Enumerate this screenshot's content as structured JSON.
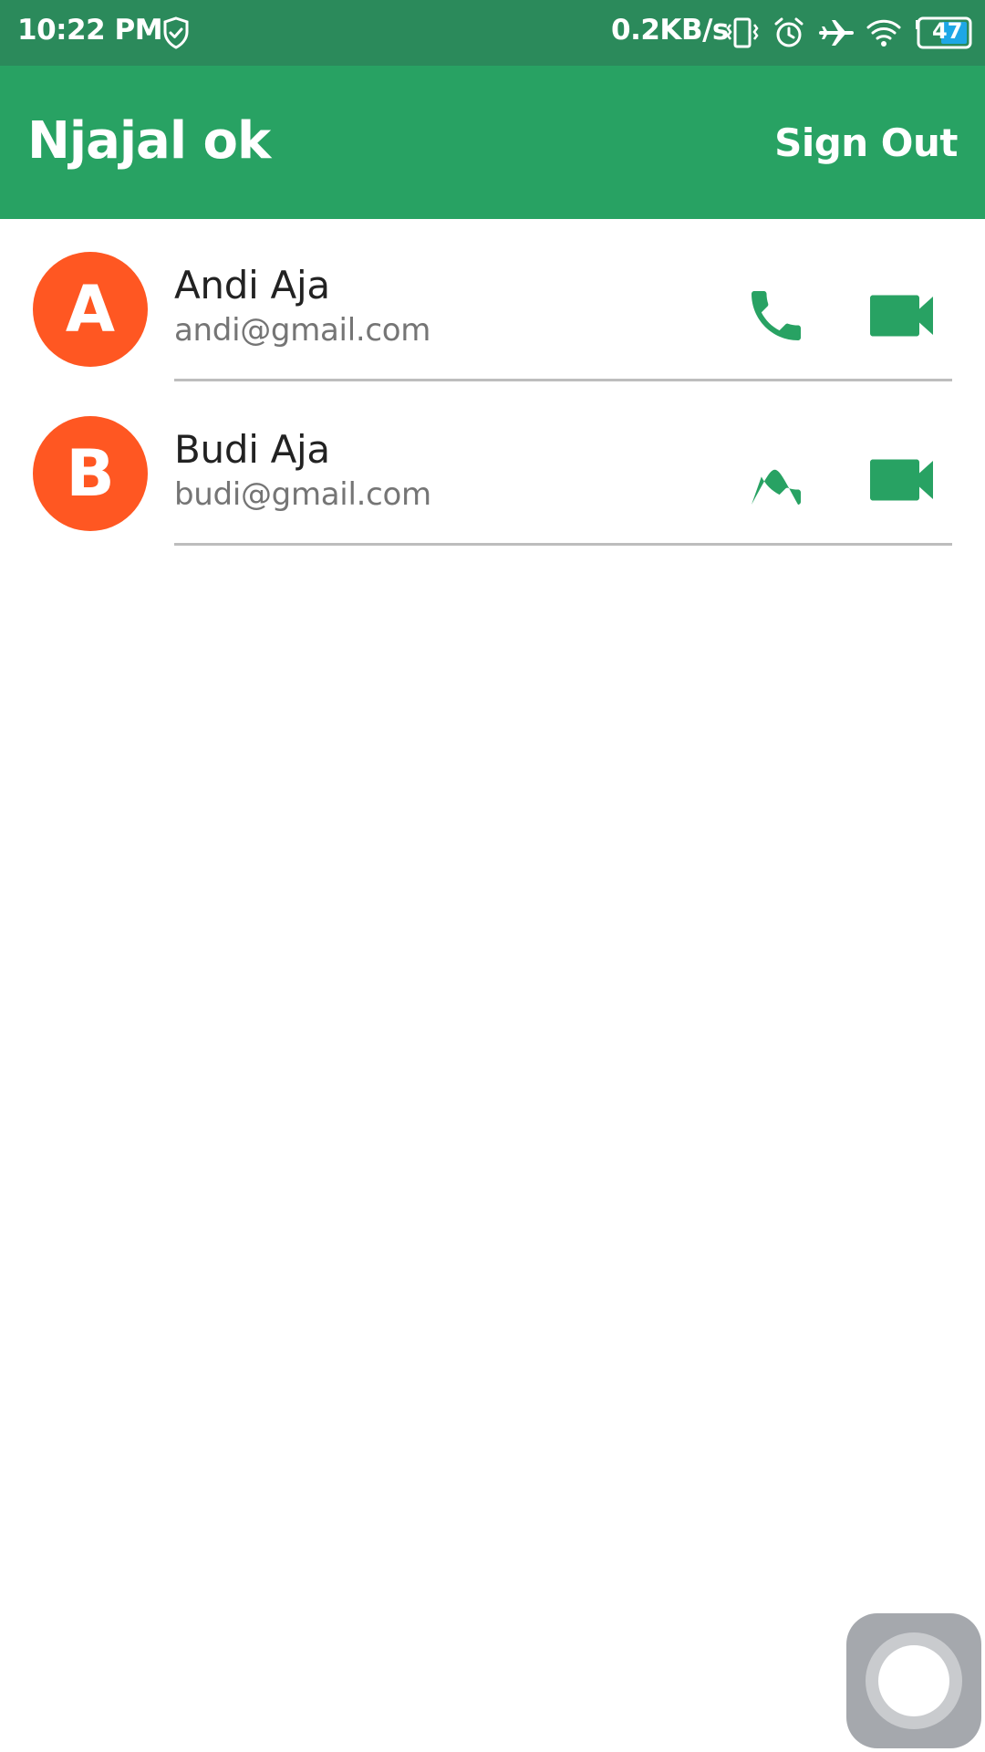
{
  "status_bar": {
    "time": "10:22 PM",
    "network_speed": "0.2KB/s",
    "battery_level": "47",
    "icons": [
      "shield-check-icon",
      "vibrate-icon",
      "alarm-icon",
      "airplane-icon",
      "wifi-icon",
      "battery-icon"
    ]
  },
  "app_bar": {
    "title": "Njajal ok",
    "sign_out_label": "Sign Out"
  },
  "colors": {
    "status_bar": "#2b8a5b",
    "app_bar": "#28a263",
    "accent_green": "#28a263",
    "avatar": "#ff5722",
    "divider": "#bdbdbd"
  },
  "contacts": [
    {
      "initial": "A",
      "name": "Andi Aja",
      "email": "andi@gmail.com",
      "actions": [
        "phone-icon",
        "video-camera-icon"
      ]
    },
    {
      "initial": "B",
      "name": "Budi Aja",
      "email": "budi@gmail.com",
      "actions": [
        "phone-icon",
        "video-camera-icon"
      ]
    }
  ]
}
